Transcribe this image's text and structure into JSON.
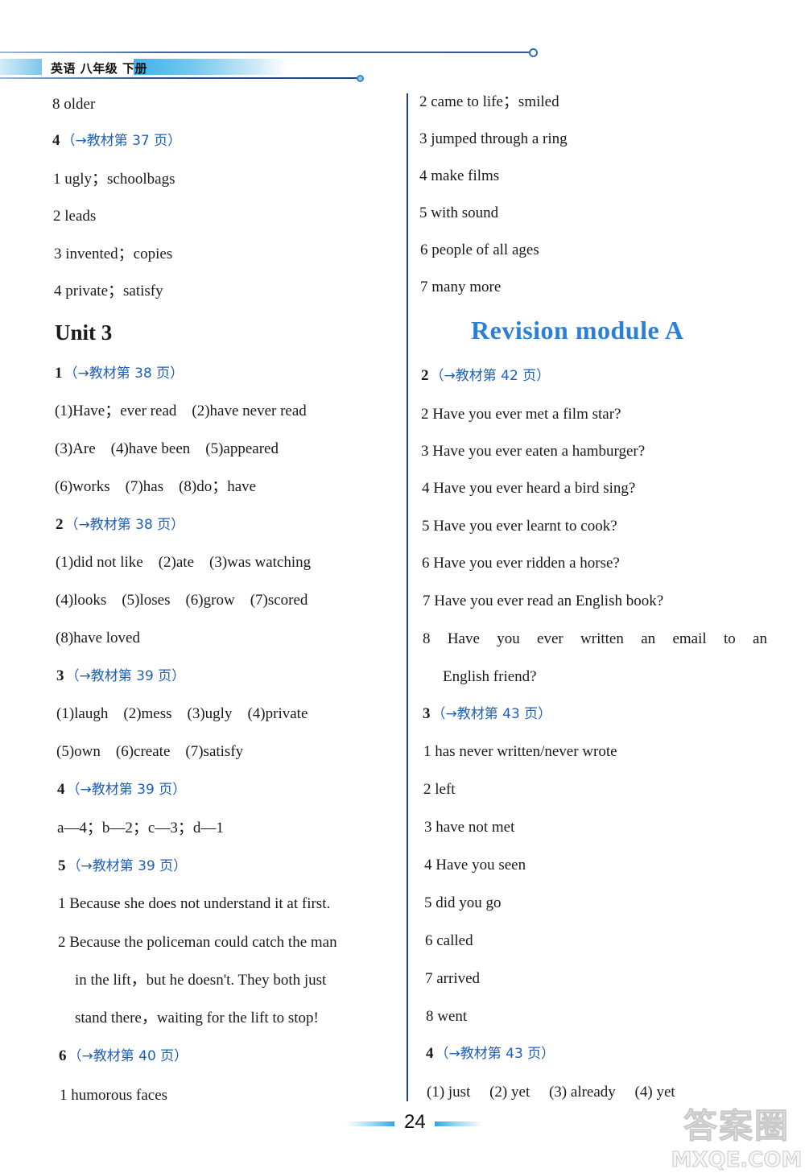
{
  "header": {
    "title": "英语 八年级 下册"
  },
  "left": {
    "carry": "8 older",
    "q4_prev": {
      "num": "4",
      "ref": "（→教材第 37 页）",
      "answers": [
        "1 ugly；schoolbags",
        "2 leads",
        "3 invented；copies",
        "4 private；satisfy"
      ]
    },
    "unit_title": "Unit 3",
    "q1": {
      "num": "1",
      "ref": "（→教材第 38 页）",
      "rows": [
        [
          "(1)Have；ever read",
          "(2)have never read"
        ],
        [
          "(3)Are",
          "(4)have been",
          "(5)appeared"
        ],
        [
          "(6)works",
          "(7)has",
          "(8)do；have"
        ]
      ]
    },
    "q2": {
      "num": "2",
      "ref": "（→教材第 38 页）",
      "rows": [
        [
          "(1)did not like",
          "(2)ate",
          "(3)was watching"
        ],
        [
          "(4)looks",
          "(5)loses",
          "(6)grow",
          "(7)scored"
        ],
        [
          "(8)have loved"
        ]
      ]
    },
    "q3": {
      "num": "3",
      "ref": "（→教材第 39 页）",
      "rows": [
        [
          "(1)laugh",
          "(2)mess",
          "(3)ugly",
          "(4)private"
        ],
        [
          "(5)own",
          "(6)create",
          "(7)satisfy"
        ]
      ]
    },
    "q4": {
      "num": "4",
      "ref": "（→教材第 39 页）",
      "answer": "a—4；b—2；c—3；d—1"
    },
    "q5": {
      "num": "5",
      "ref": "（→教材第 39 页）",
      "a1": "1 Because she does not understand it at first.",
      "a2_lines": [
        "2 Because the policeman could catch the man",
        "in the lift，but he doesn't. They both just",
        "stand there，waiting for the lift to stop!"
      ]
    },
    "q6": {
      "num": "6",
      "ref": "（→教材第 40 页）",
      "answers": [
        "1 humorous faces"
      ]
    }
  },
  "right": {
    "carry": [
      "2 came to life；smiled",
      "3 jumped through a ring",
      "4 make films",
      "5 with sound",
      "6 people of all ages",
      "7 many more"
    ],
    "module_title": "Revision module A",
    "q2": {
      "num": "2",
      "ref": "（→教材第 42 页）",
      "answers": [
        "2 Have you ever met a film star?",
        "3 Have you ever eaten a hamburger?",
        "4 Have you ever heard a bird sing?",
        "5 Have you ever learnt to cook?",
        "6 Have you ever ridden a horse?",
        "7 Have you ever read an English book?"
      ],
      "a8_words": [
        "8",
        "Have",
        "you",
        "ever",
        "written",
        "an",
        "email",
        "to",
        "an"
      ],
      "a8_cont": "English friend?"
    },
    "q3": {
      "num": "3",
      "ref": "（→教材第 43 页）",
      "answers": [
        "1 has never written/never wrote",
        "2 left",
        "3 have not met",
        "4 Have you seen",
        "5 did you go",
        "6 called",
        "7 arrived",
        "8 went"
      ]
    },
    "q4": {
      "num": "4",
      "ref": "（→教材第 43 页）",
      "answers": [
        "(1) just",
        "(2) yet",
        "(3) already",
        "(4) yet"
      ]
    }
  },
  "footer": {
    "page_number": "24"
  },
  "watermark": {
    "line1": "答案圈",
    "line2": "MXQE.COM"
  }
}
